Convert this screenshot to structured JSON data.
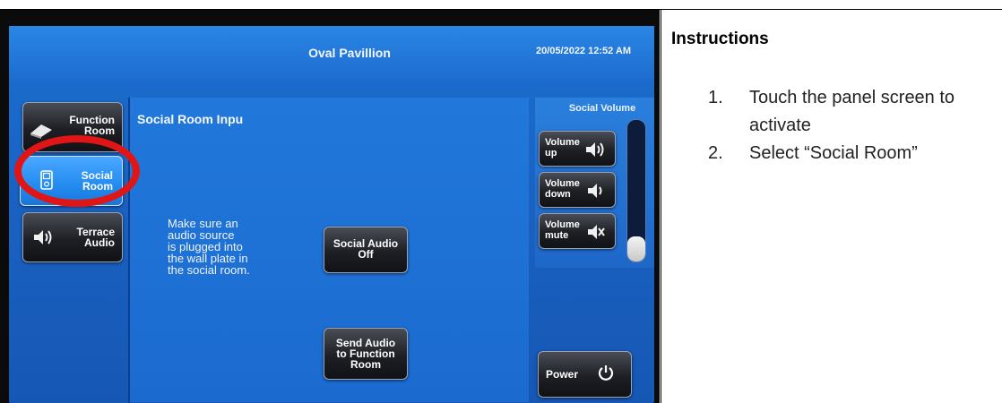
{
  "panel": {
    "title": "Oval Pavillion",
    "datetime": "20/05/2022 12:52 AM",
    "content_title": "Social Room Inpu",
    "note": "Make sure an\naudio source\nis plugged into\nthe wall plate in\nthe social room.",
    "sources": [
      {
        "label": "Function\nRoom",
        "icon": "book-icon",
        "selected": false
      },
      {
        "label": "Social\nRoom",
        "icon": "ipod-icon",
        "selected": true
      },
      {
        "label": "Terrace\nAudio",
        "icon": "speaker-icon",
        "selected": false
      }
    ],
    "actions": {
      "social_audio_off": "Social Audio\nOff",
      "send_audio": "Send Audio\nto Function\nRoom"
    },
    "volume": {
      "title": "Social Volume",
      "up": "Volume\nup",
      "down": "Volume\ndown",
      "mute": "Volume\nmute",
      "level": 0.18
    },
    "power": "Power",
    "highlight_color": "#e01616",
    "accent_color": "#1b6fd0"
  },
  "instructions": {
    "heading": "Instructions",
    "steps": [
      {
        "num": "1.",
        "text": "Touch the panel screen to activate"
      },
      {
        "num": "2.",
        "text": "Select “Social Room”"
      }
    ]
  }
}
